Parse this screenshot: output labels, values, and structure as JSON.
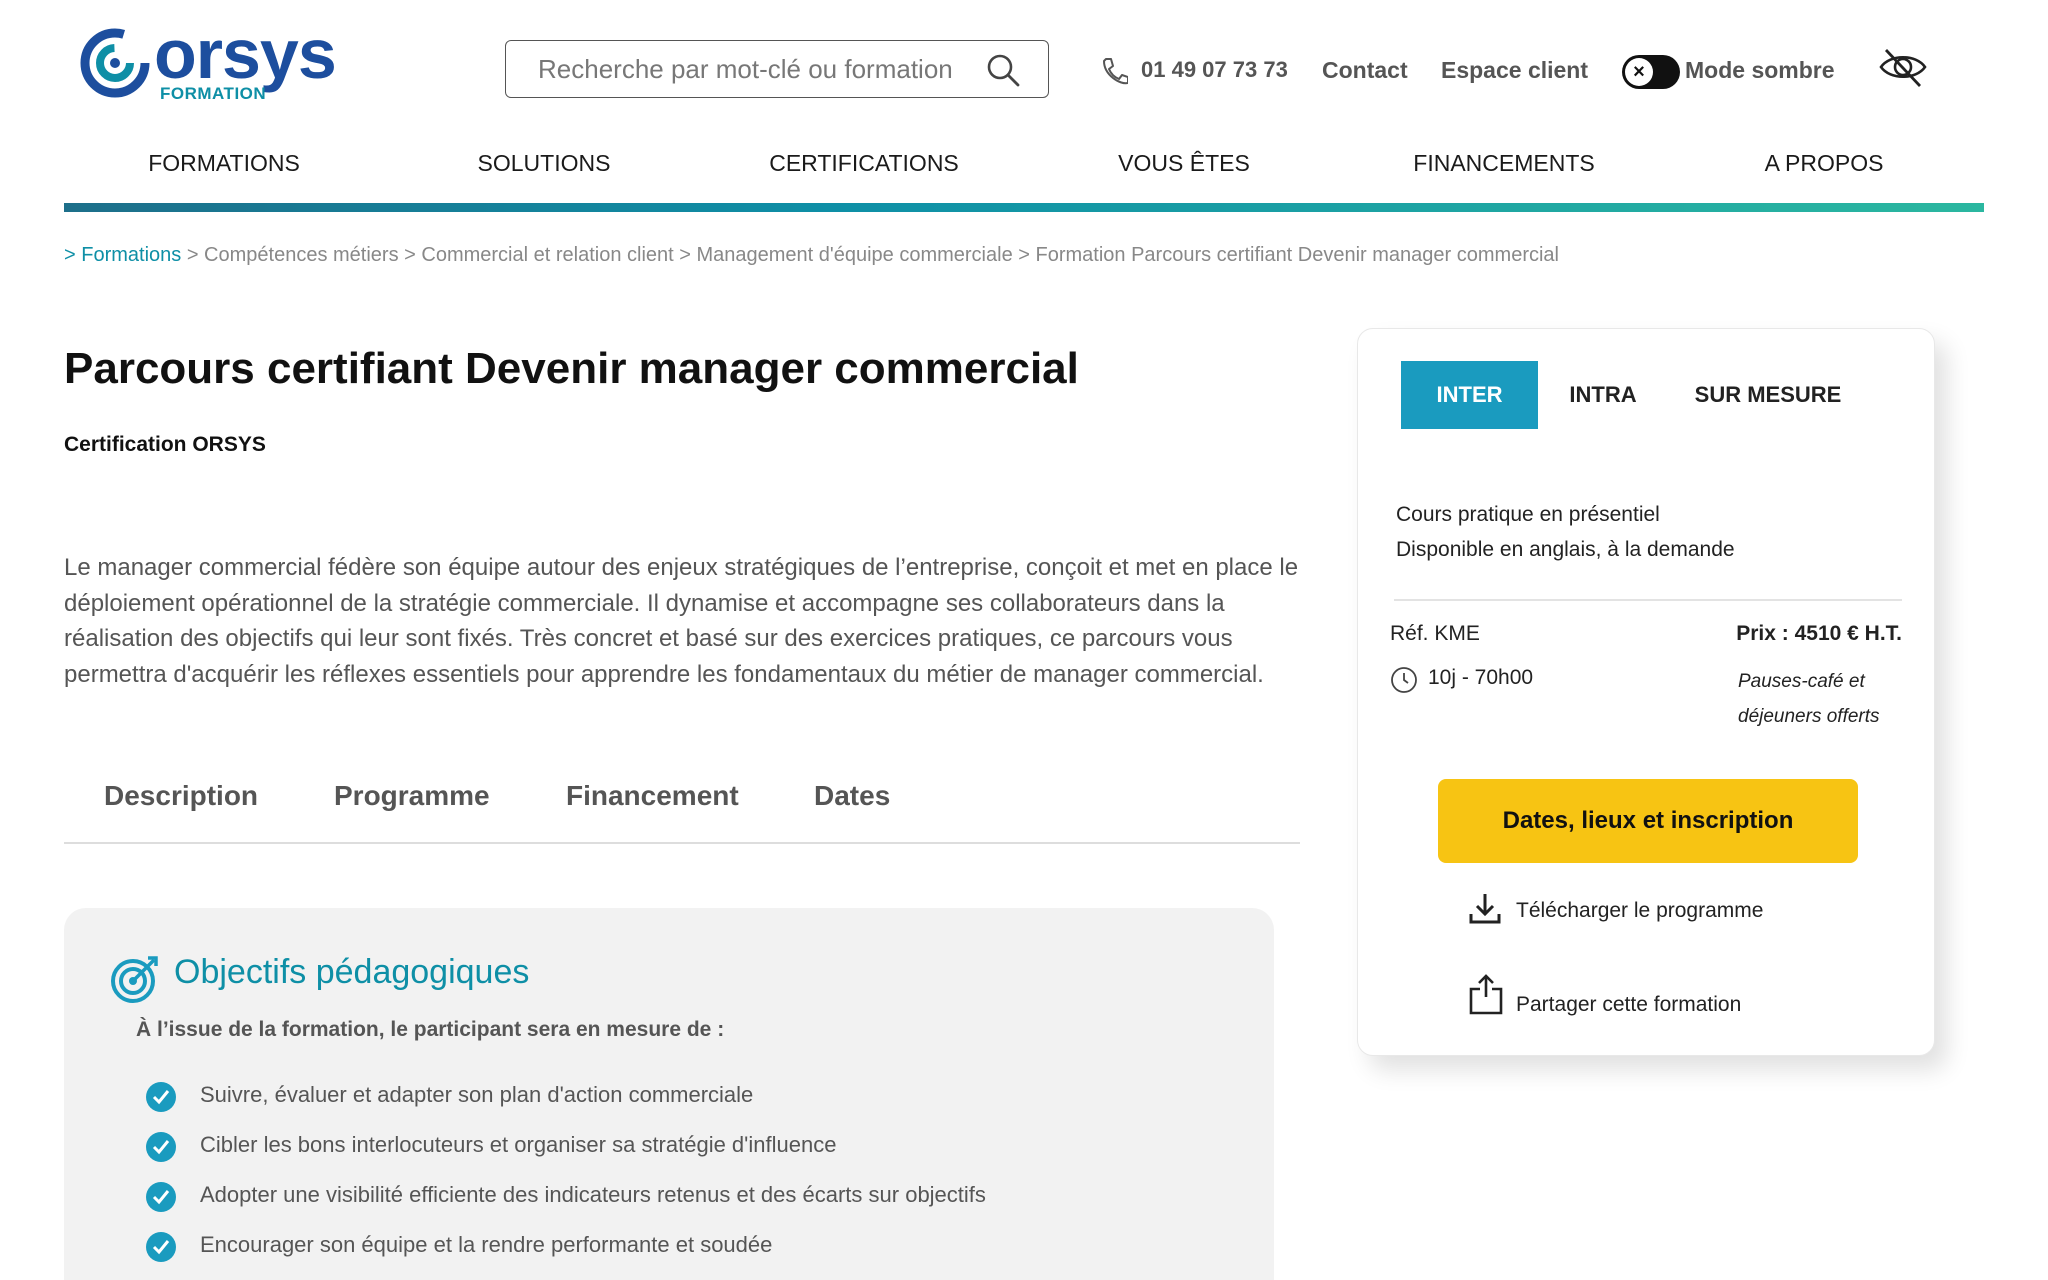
{
  "header": {
    "logo_text": "orsys",
    "logo_sub": "FORMATION",
    "search_placeholder": "Recherche par mot-clé ou formation",
    "phone": "01 49 07 73 73",
    "contact": "Contact",
    "espace_client": "Espace client",
    "dark_mode_label": "Mode sombre",
    "brand_color": "#1d4e9e",
    "accent_color": "#0e8fa6"
  },
  "nav": [
    "FORMATIONS",
    "SOLUTIONS",
    "CERTIFICATIONS",
    "VOUS ÊTES",
    "FINANCEMENTS",
    "A PROPOS"
  ],
  "breadcrumb": {
    "first": "> Formations",
    "rest": " > Compétences métiers > Commercial et relation client > Management d'équipe commerciale > Formation Parcours certifiant Devenir manager commercial"
  },
  "main": {
    "title": "Parcours certifiant Devenir manager commercial",
    "certification": "Certification ORSYS",
    "description": "Le manager commercial fédère son équipe autour des enjeux stratégiques de l’entreprise, conçoit et met en place le déploiement opérationnel de la stratégie commerciale. Il dynamise et accompagne ses collaborateurs dans la réalisation des objectifs qui leur sont fixés. Très concret et basé sur des exercices pratiques, ce parcours vous permettra d'acquérir les réflexes essentiels pour apprendre les fondamentaux du métier de manager commercial.",
    "tabs": [
      "Description",
      "Programme",
      "Financement",
      "Dates"
    ]
  },
  "objectives": {
    "title": "Objectifs pédagogiques",
    "intro": "À l’issue de la formation, le participant sera en mesure de :",
    "items": [
      "Suivre, évaluer et adapter son plan d'action commerciale",
      "Cibler les bons interlocuteurs et organiser sa stratégie d'influence",
      "Adopter une visibilité efficiente des indicateurs retenus et des écarts sur objectifs",
      "Encourager son équipe et la rendre performante et soudée"
    ]
  },
  "card": {
    "segments": [
      "INTER",
      "INTRA",
      "SUR MESURE"
    ],
    "active_segment": "INTER",
    "info_line1": "Cours pratique en présentiel",
    "info_line2": "Disponible en anglais, à la demande",
    "ref": "Réf. KME",
    "price": "Prix : 4510 € H.T.",
    "duration": "10j - 70h00",
    "pauses": "Pauses-café et déjeuners offerts",
    "cta": "Dates, lieux et inscription",
    "download": "Télécharger le programme",
    "share": "Partager cette formation",
    "cta_color": "#f7c413",
    "segment_active_color": "#1a9bbf"
  },
  "icons": {
    "search": "search-icon",
    "phone": "phone-icon",
    "toggle": "close-icon",
    "accessibility": "eye-slash-icon",
    "objectives": "target-icon",
    "check": "check-circle-icon",
    "clock": "clock-icon",
    "download": "download-icon",
    "share": "share-icon"
  }
}
